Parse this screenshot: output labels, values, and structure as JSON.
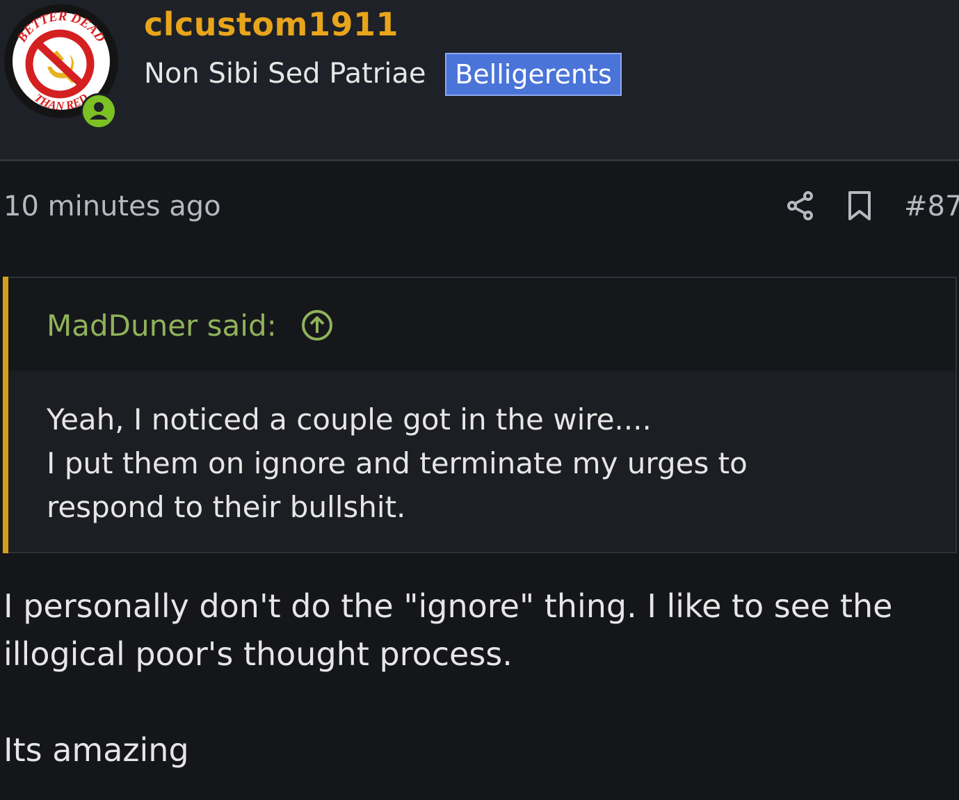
{
  "post": {
    "author": {
      "username": "clcustom1911",
      "user_title": "Non Sibi Sed Patriae",
      "group_badge": "Belligerents",
      "avatar_text_top": "BETTER DEAD",
      "avatar_text_bottom": "THAN RED",
      "online": true
    },
    "timestamp": "10 minutes ago",
    "post_number": "#87",
    "quote": {
      "attribution": "MadDuner said:",
      "lines": [
        "Yeah, I noticed a couple got in the wire....",
        "I put them on ignore and terminate my urges to",
        "respond to their bullshit."
      ]
    },
    "body_lines": [
      "I personally don't do the \"ignore\" thing. I like to see the",
      "illogical poor's thought process.",
      "",
      "Its amazing"
    ]
  },
  "colors": {
    "username": "#e8a51b",
    "badge_bg": "#4a74d8",
    "quote_accent": "#d4a01c",
    "quote_author": "#8fb35a",
    "online_dot": "#7cc024"
  },
  "icons": [
    "share-icon",
    "bookmark-icon",
    "quote-jump-icon",
    "user-icon"
  ]
}
